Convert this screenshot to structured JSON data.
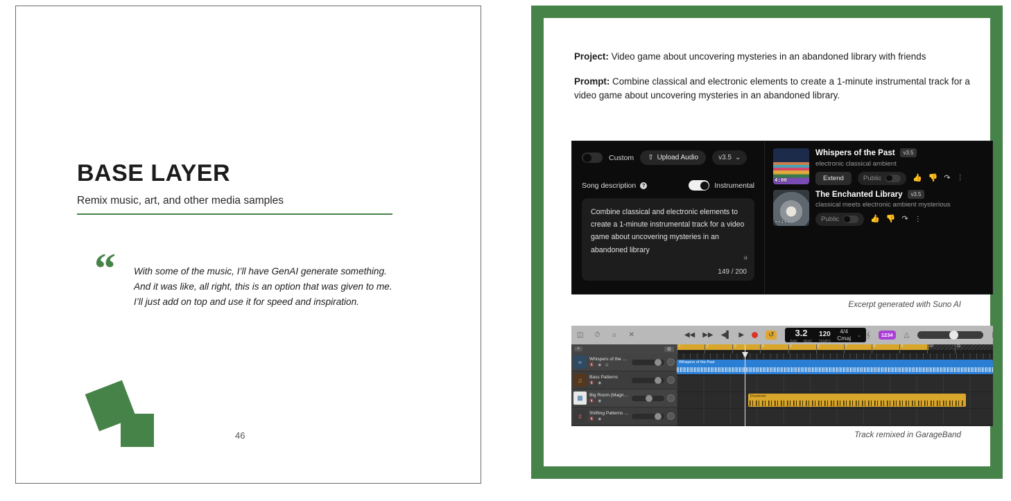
{
  "left_slide": {
    "title": "BASE LAYER",
    "subtitle": "Remix music, art, and other media samples",
    "quote_mark": "“",
    "quote": "With some of the music, I’ll have GenAI generate something. And it was like, all right, this is an option that was given to me. I’ll just add on top and use it for speed and inspiration.",
    "page_number": "46",
    "accent_color": "#468348"
  },
  "right_slide": {
    "border_color": "#468348",
    "project_label": "Project:",
    "project_text": " Video game about uncovering mysteries in an abandoned library with friends",
    "prompt_label": "Prompt:",
    "prompt_text": " Combine classical and electronic elements to create a 1-minute instrumental track for a video game about uncovering mysteries in an abandoned library.",
    "suno_caption": "Excerpt generated with Suno AI",
    "garageband_caption": "Track remixed in GarageBand"
  },
  "suno": {
    "custom_label": "Custom",
    "upload_label": "Upload Audio",
    "upload_icon": "upload-icon",
    "version_label": "v3.5",
    "version_chevron": "⌄",
    "song_description_label": "Song description",
    "help_icon_label": "?",
    "instrumental_label": "Instrumental",
    "description_value": "Combine classical and electronic elements to create a 1-minute instrumental track for a video game about uncovering mysteries in an abandoned library",
    "resize_grip": "⧺",
    "char_count": "149 / 200",
    "songs": [
      {
        "title": "Whispers of the Past",
        "version": "v3.5",
        "tags": "electronic classical ambient",
        "duration": "4:00",
        "extend_label": "Extend",
        "public_label": "Public",
        "like_icon": "👍",
        "dislike_icon": "👎",
        "share_icon": "↪",
        "more_icon": "⋮"
      },
      {
        "title": "The Enchanted Library",
        "version": "v3.5",
        "tags": "classical meets electronic ambient mysterious",
        "duration": "--:--",
        "extend_label": "",
        "public_label": "Public",
        "like_icon": "👍",
        "dislike_icon": "👎",
        "share_icon": "↪",
        "more_icon": "⋮"
      }
    ]
  },
  "garageband": {
    "toolbar_icons": [
      "library-icon",
      "clock-icon",
      "settings-icon",
      "close-icon"
    ],
    "transport": {
      "rewind": "◀◀",
      "forward": "▶▶",
      "go_to_start": "◀|",
      "play": "▶",
      "record": "record-icon",
      "cycle": "↺"
    },
    "lcd": {
      "position": "3.2",
      "position_sub_left": "BAR",
      "position_sub_right": "BEAT",
      "tempo": "120",
      "tempo_sub": "TEMPO",
      "signature": "4/4",
      "key": "Cmaj",
      "chevron": "⌄"
    },
    "count_in_badge": "1234",
    "metronome_icon": "metronome-icon",
    "master_volume": 50,
    "right_icons": [
      "loops-icon",
      "notes-icon"
    ],
    "add_track_label": "+",
    "tracks": [
      {
        "name": "Whispers of the Past",
        "icon": "audio-waveform-icon",
        "buttons": "● ● ●",
        "volume": 70
      },
      {
        "name": "Bass Patterns",
        "icon": "bass-amp-icon",
        "buttons": "● ●",
        "volume": 70
      },
      {
        "name": "Big Room (Magnus)",
        "icon": "drummer-icon",
        "buttons": "● ●",
        "volume": 42
      },
      {
        "name": "Shifting Patterns Synth",
        "icon": "synth-icon",
        "buttons": "● ●",
        "volume": 70
      }
    ],
    "ruler_marks": [
      "1",
      "2",
      "3",
      "4",
      "5",
      "6",
      "7",
      "8",
      "9",
      "10",
      "11"
    ],
    "cycle_range_end_bar": 9,
    "regions": [
      {
        "name": "Whispers of the Past",
        "type": "audio",
        "track": 0
      },
      {
        "name": "Drummer",
        "type": "midi",
        "track": 2
      }
    ],
    "playhead_bar": "3.2"
  }
}
